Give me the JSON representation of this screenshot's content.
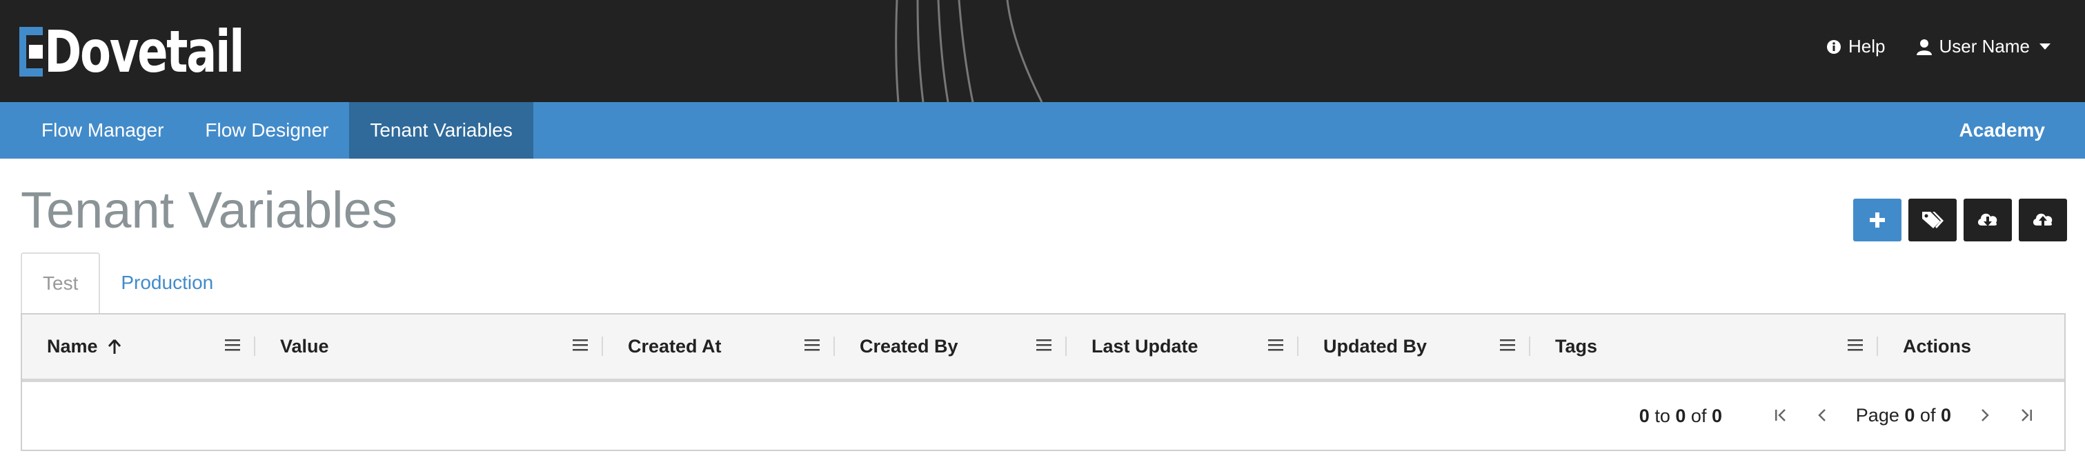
{
  "header": {
    "logo_text": "Dovetail",
    "help_label": "Help",
    "user_label": "User Name"
  },
  "nav": {
    "items": [
      {
        "label": "Flow Manager"
      },
      {
        "label": "Flow Designer"
      },
      {
        "label": "Tenant Variables",
        "active": true
      }
    ],
    "right_label": "Academy"
  },
  "page": {
    "title": "Tenant Variables",
    "actions": [
      {
        "icon": "plus-icon"
      },
      {
        "icon": "tags-icon"
      },
      {
        "icon": "cloud-download-icon"
      },
      {
        "icon": "cloud-upload-icon"
      }
    ]
  },
  "tabs": [
    {
      "label": "Test",
      "active": true
    },
    {
      "label": "Production",
      "active": false
    }
  ],
  "table": {
    "columns": [
      {
        "label": "Name",
        "sorted": "asc"
      },
      {
        "label": "Value"
      },
      {
        "label": "Created At"
      },
      {
        "label": "Created By"
      },
      {
        "label": "Last Update"
      },
      {
        "label": "Updated By"
      },
      {
        "label": "Tags"
      },
      {
        "label": "Actions"
      }
    ],
    "footer": {
      "from": "0",
      "to_word": "to",
      "to": "0",
      "of_word": "of",
      "total": "0",
      "page_word": "Page",
      "page": "0",
      "page_of_word": "of",
      "pages": "0"
    }
  },
  "colors": {
    "topbar": "#222222",
    "nav": "#428bca",
    "nav_active": "#2f6a9a",
    "title": "#8a9396"
  }
}
